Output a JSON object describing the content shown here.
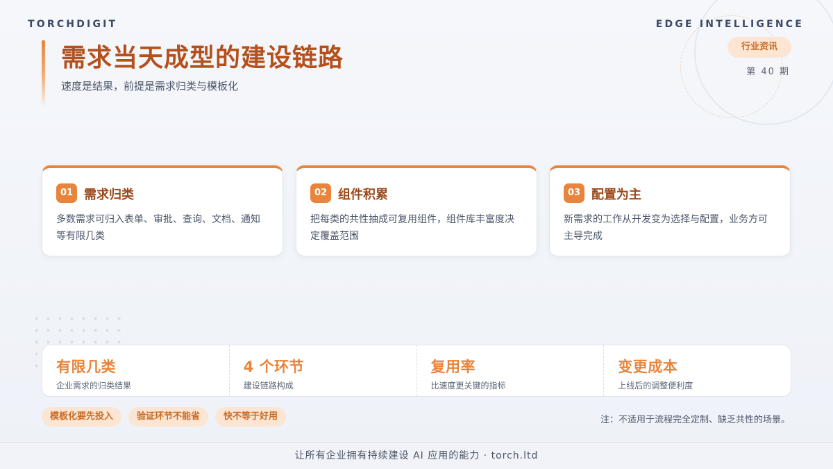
{
  "header": {
    "brand_left": "TORCHDIGIT",
    "brand_right": "EDGE INTELLIGENCE",
    "tag": "行业资讯",
    "issue": "第 40 期"
  },
  "title": {
    "main": "需求当天成型的建设链路",
    "subtitle": "速度是结果，前提是需求归类与模板化"
  },
  "cards": [
    {
      "num": "01",
      "title": "需求归类",
      "desc": "多数需求可归入表单、审批、查询、文档、通知等有限几类"
    },
    {
      "num": "02",
      "title": "组件积累",
      "desc": "把每类的共性抽成可复用组件，组件库丰富度决定覆盖范围"
    },
    {
      "num": "03",
      "title": "配置为主",
      "desc": "新需求的工作从开发变为选择与配置，业务方可主导完成"
    }
  ],
  "stats": [
    {
      "value": "有限几类",
      "label": "企业需求的归类结果"
    },
    {
      "value": "4 个环节",
      "label": "建设链路构成"
    },
    {
      "value": "复用率",
      "label": "比速度更关键的指标"
    },
    {
      "value": "变更成本",
      "label": "上线后的调整便利度"
    }
  ],
  "chips": [
    "模板化要先投入",
    "验证环节不能省",
    "快不等于好用"
  ],
  "note": "注：不适用于流程完全定制、缺乏共性的场景。",
  "footer": "让所有企业拥有持续建设 AI 应用的能力 · torch.ltd",
  "colors": {
    "accent": "#e8843c",
    "title": "#b4501c"
  }
}
